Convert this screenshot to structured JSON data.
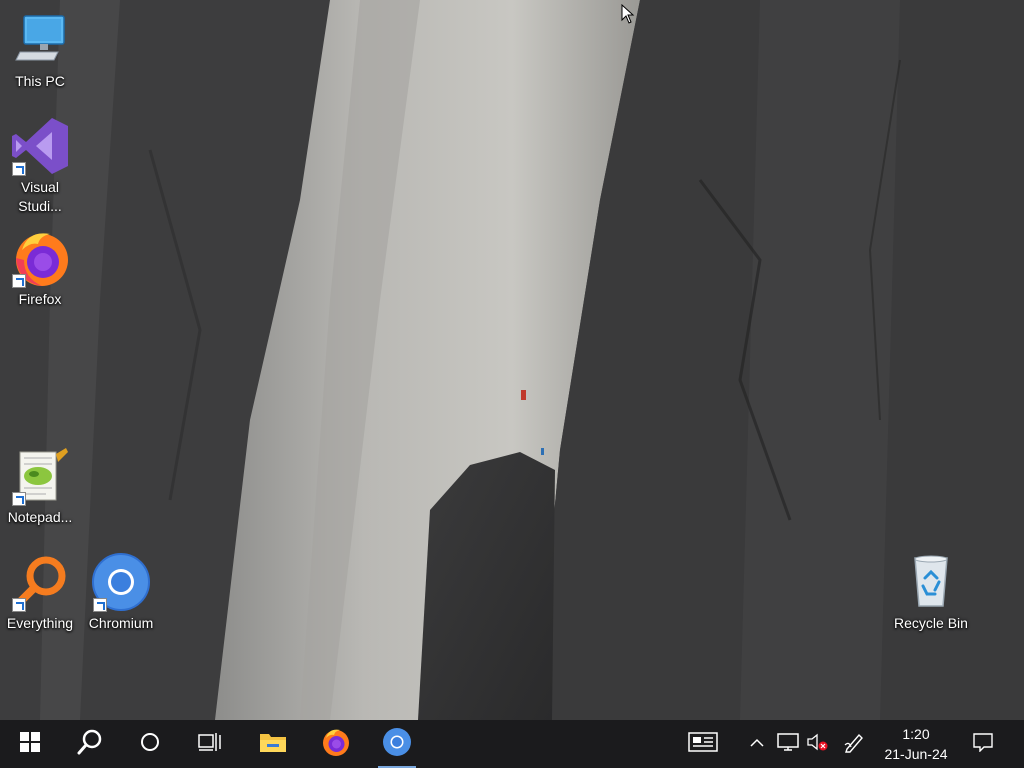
{
  "desktop": {
    "icons": [
      {
        "id": "this-pc",
        "label": "This PC",
        "shortcut": false,
        "icon": "computer-icon"
      },
      {
        "id": "visual-studio",
        "label": "Visual Studi...",
        "shortcut": true,
        "icon": "visual-studio-icon"
      },
      {
        "id": "firefox",
        "label": "Firefox",
        "shortcut": true,
        "icon": "firefox-icon"
      },
      {
        "id": "notepad",
        "label": "Notepad...",
        "shortcut": true,
        "icon": "notepad-plus-plus-icon"
      },
      {
        "id": "everything",
        "label": "Everything",
        "shortcut": true,
        "icon": "magnifier-icon"
      },
      {
        "id": "chromium",
        "label": "Chromium",
        "shortcut": true,
        "icon": "chromium-icon"
      },
      {
        "id": "recycle-bin",
        "label": "Recycle Bin",
        "shortcut": false,
        "icon": "recycle-bin-icon"
      }
    ]
  },
  "taskbar": {
    "start": {
      "icon": "windows-logo-icon"
    },
    "search": {
      "icon": "search-icon"
    },
    "cortana": {
      "icon": "cortana-circle-icon"
    },
    "task_view": {
      "icon": "task-view-icon"
    },
    "pinned": [
      {
        "id": "file-explorer",
        "icon": "folder-icon"
      },
      {
        "id": "firefox",
        "icon": "firefox-icon"
      },
      {
        "id": "chromium",
        "icon": "chromium-icon",
        "active": true
      }
    ],
    "tray": {
      "news_icon": "news-widget-icon",
      "overflow_icon": "chevron-up-icon",
      "network_icon": "network-icon",
      "volume_icon": "volume-muted-icon",
      "pen_icon": "pen-workspace-icon",
      "time": "1:20",
      "date": "21-Jun-24",
      "notification_icon": "action-center-icon"
    }
  },
  "colors": {
    "taskbar_bg": "#1b1b1d",
    "accent": "#7aa7dc"
  }
}
